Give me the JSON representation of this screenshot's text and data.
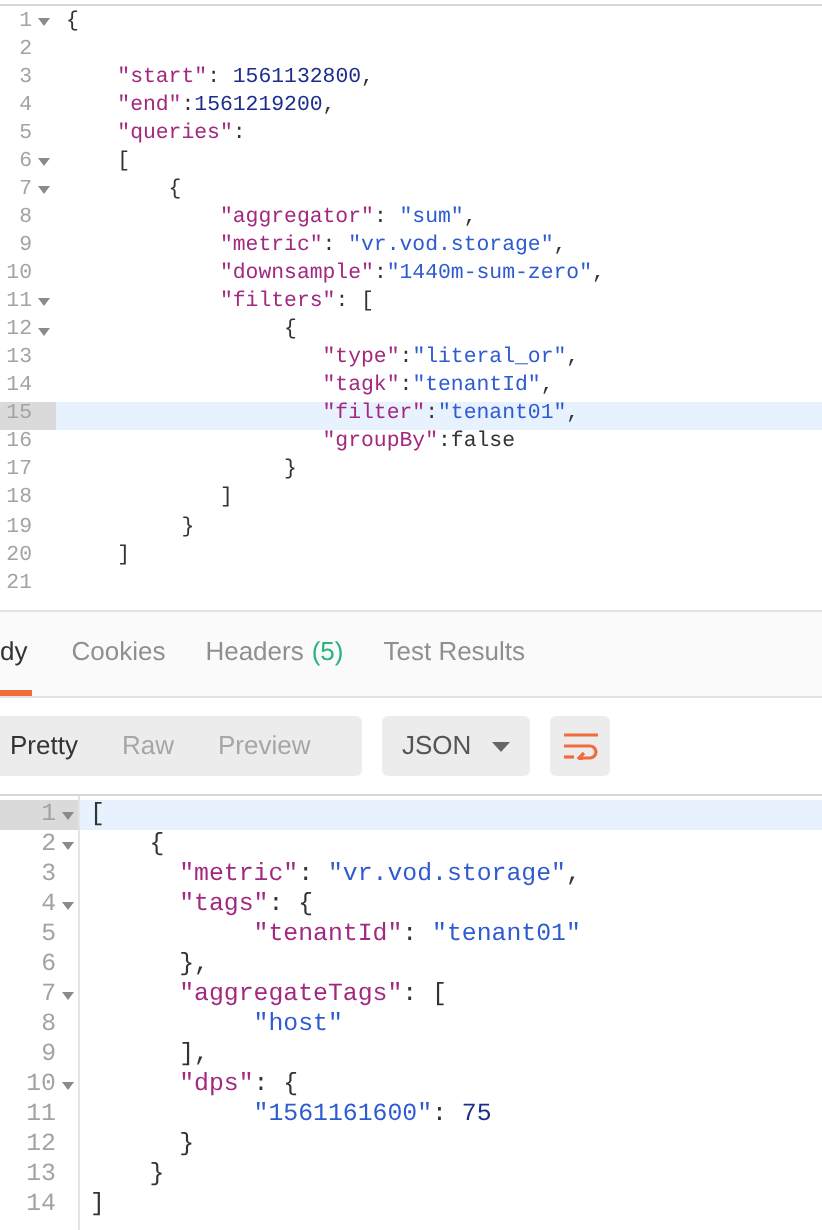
{
  "request_editor": {
    "lines": [
      {
        "number": "1",
        "foldable": true,
        "active": false,
        "tokens": [
          {
            "kind": "punct",
            "text": "{"
          }
        ]
      },
      {
        "number": "2",
        "foldable": false,
        "active": false
      },
      {
        "number": "3",
        "foldable": false,
        "active": false,
        "tokens": [
          {
            "kind": "key",
            "text": "    \"start\""
          },
          {
            "kind": "punct",
            "text": ": "
          },
          {
            "kind": "number",
            "text": "1561132800"
          },
          {
            "kind": "punct",
            "text": ","
          }
        ]
      },
      {
        "number": "4",
        "foldable": false,
        "active": false,
        "tokens": [
          {
            "kind": "key",
            "text": "    \"end\""
          },
          {
            "kind": "punct",
            "text": ":"
          },
          {
            "kind": "number",
            "text": "1561219200"
          },
          {
            "kind": "punct",
            "text": ","
          }
        ]
      },
      {
        "number": "5",
        "foldable": false,
        "active": false,
        "tokens": [
          {
            "kind": "key",
            "text": "    \"queries\""
          },
          {
            "kind": "punct",
            "text": ":"
          }
        ]
      },
      {
        "number": "6",
        "foldable": true,
        "active": false,
        "tokens": [
          {
            "kind": "punct",
            "text": "    ["
          }
        ]
      },
      {
        "number": "7",
        "foldable": true,
        "active": false,
        "tokens": [
          {
            "kind": "punct",
            "text": "        {"
          }
        ]
      },
      {
        "number": "8",
        "foldable": false,
        "active": false,
        "tokens": [
          {
            "kind": "key",
            "text": "            \"aggregator\""
          },
          {
            "kind": "punct",
            "text": ": "
          },
          {
            "kind": "string",
            "text": "\"sum\""
          },
          {
            "kind": "punct",
            "text": ","
          }
        ]
      },
      {
        "number": "9",
        "foldable": false,
        "active": false,
        "tokens": [
          {
            "kind": "key",
            "text": "            \"metric\""
          },
          {
            "kind": "punct",
            "text": ": "
          },
          {
            "kind": "string",
            "text": "\"vr.vod.storage\""
          },
          {
            "kind": "punct",
            "text": ","
          }
        ]
      },
      {
        "number": "10",
        "foldable": false,
        "active": false,
        "tokens": [
          {
            "kind": "key",
            "text": "            \"downsample\""
          },
          {
            "kind": "punct",
            "text": ":"
          },
          {
            "kind": "string",
            "text": "\"1440m-sum-zero\""
          },
          {
            "kind": "punct",
            "text": ","
          }
        ]
      },
      {
        "number": "11",
        "foldable": true,
        "active": false,
        "tokens": [
          {
            "kind": "key",
            "text": "            \"filters\""
          },
          {
            "kind": "punct",
            "text": ": ["
          }
        ]
      },
      {
        "number": "12",
        "foldable": true,
        "active": false,
        "tokens": [
          {
            "kind": "punct",
            "text": "                 {"
          }
        ]
      },
      {
        "number": "13",
        "foldable": false,
        "active": false,
        "tokens": [
          {
            "kind": "key",
            "text": "                    \"type\""
          },
          {
            "kind": "punct",
            "text": ":"
          },
          {
            "kind": "string",
            "text": "\"literal_or\""
          },
          {
            "kind": "punct",
            "text": ","
          }
        ]
      },
      {
        "number": "14",
        "foldable": false,
        "active": false,
        "tokens": [
          {
            "kind": "key",
            "text": "                    \"tagk\""
          },
          {
            "kind": "punct",
            "text": ":"
          },
          {
            "kind": "string",
            "text": "\"tenantId\""
          },
          {
            "kind": "punct",
            "text": ","
          }
        ]
      },
      {
        "number": "15",
        "foldable": false,
        "active": true,
        "tokens": [
          {
            "kind": "key",
            "text": "                    \"filter\""
          },
          {
            "kind": "punct",
            "text": ":"
          },
          {
            "kind": "string",
            "text": "\"tenant01\""
          },
          {
            "kind": "punct",
            "text": ","
          }
        ]
      },
      {
        "number": "16",
        "foldable": false,
        "active": false,
        "tokens": [
          {
            "kind": "key",
            "text": "                    \"groupBy\""
          },
          {
            "kind": "punct",
            "text": ":"
          },
          {
            "kind": "literal",
            "text": "false"
          }
        ]
      },
      {
        "number": "17",
        "foldable": false,
        "active": false,
        "tokens": [
          {
            "kind": "punct",
            "text": "                 }"
          }
        ]
      },
      {
        "number": "18",
        "foldable": false,
        "active": false,
        "tokens": [
          {
            "kind": "punct",
            "text": "            ]"
          }
        ]
      },
      {
        "number": "19",
        "foldable": false,
        "active": false,
        "tokens": [
          {
            "kind": "punct",
            "text": "         }"
          }
        ]
      },
      {
        "number": "20",
        "foldable": false,
        "active": false,
        "tokens": [
          {
            "kind": "punct",
            "text": "    ]"
          }
        ]
      },
      {
        "number": "21",
        "foldable": false,
        "active": false
      }
    ]
  },
  "response_tabs": [
    {
      "label": "dy",
      "selected": true
    },
    {
      "label": "Cookies",
      "selected": false
    },
    {
      "label": "Headers",
      "count": "(5)",
      "selected": false
    },
    {
      "label": "Test Results",
      "selected": false
    }
  ],
  "view_modes": [
    {
      "label": "Pretty",
      "selected": true
    },
    {
      "label": "Raw",
      "selected": false
    },
    {
      "label": "Preview",
      "selected": false
    }
  ],
  "format_select": {
    "value": "JSON"
  },
  "response_editor": {
    "lines": [
      {
        "number": "1",
        "foldable": true,
        "active": true,
        "tokens": [
          {
            "kind": "punct",
            "text": "["
          }
        ]
      },
      {
        "number": "2",
        "foldable": true,
        "active": false,
        "tokens": [
          {
            "kind": "punct",
            "text": "    {"
          }
        ]
      },
      {
        "number": "3",
        "foldable": false,
        "active": false,
        "tokens": [
          {
            "kind": "key",
            "text": "      \"metric\""
          },
          {
            "kind": "punct",
            "text": ": "
          },
          {
            "kind": "string",
            "text": "\"vr.vod.storage\""
          },
          {
            "kind": "punct",
            "text": ","
          }
        ]
      },
      {
        "number": "4",
        "foldable": true,
        "active": false,
        "tokens": [
          {
            "kind": "key",
            "text": "      \"tags\""
          },
          {
            "kind": "punct",
            "text": ": {"
          }
        ]
      },
      {
        "number": "5",
        "foldable": false,
        "active": false,
        "tokens": [
          {
            "kind": "key",
            "text": "           \"tenantId\""
          },
          {
            "kind": "punct",
            "text": ": "
          },
          {
            "kind": "string",
            "text": "\"tenant01\""
          }
        ]
      },
      {
        "number": "6",
        "foldable": false,
        "active": false,
        "tokens": [
          {
            "kind": "punct",
            "text": "      },"
          }
        ]
      },
      {
        "number": "7",
        "foldable": true,
        "active": false,
        "tokens": [
          {
            "kind": "key",
            "text": "      \"aggregateTags\""
          },
          {
            "kind": "punct",
            "text": ": ["
          }
        ]
      },
      {
        "number": "8",
        "foldable": false,
        "active": false,
        "tokens": [
          {
            "kind": "string",
            "text": "           \"host\""
          }
        ]
      },
      {
        "number": "9",
        "foldable": false,
        "active": false,
        "tokens": [
          {
            "kind": "punct",
            "text": "      ],"
          }
        ]
      },
      {
        "number": "10",
        "foldable": true,
        "active": false,
        "tokens": [
          {
            "kind": "key",
            "text": "      \"dps\""
          },
          {
            "kind": "punct",
            "text": ": {"
          }
        ]
      },
      {
        "number": "11",
        "foldable": false,
        "active": false,
        "tokens": [
          {
            "kind": "string",
            "text": "           \"1561161600\""
          },
          {
            "kind": "punct",
            "text": ": "
          },
          {
            "kind": "number",
            "text": "75"
          }
        ]
      },
      {
        "number": "12",
        "foldable": false,
        "active": false,
        "tokens": [
          {
            "kind": "punct",
            "text": "      }"
          }
        ]
      },
      {
        "number": "13",
        "foldable": false,
        "active": false,
        "tokens": [
          {
            "kind": "punct",
            "text": "    }"
          }
        ]
      },
      {
        "number": "14",
        "foldable": false,
        "active": false,
        "tokens": [
          {
            "kind": "punct",
            "text": "]"
          }
        ]
      }
    ]
  }
}
